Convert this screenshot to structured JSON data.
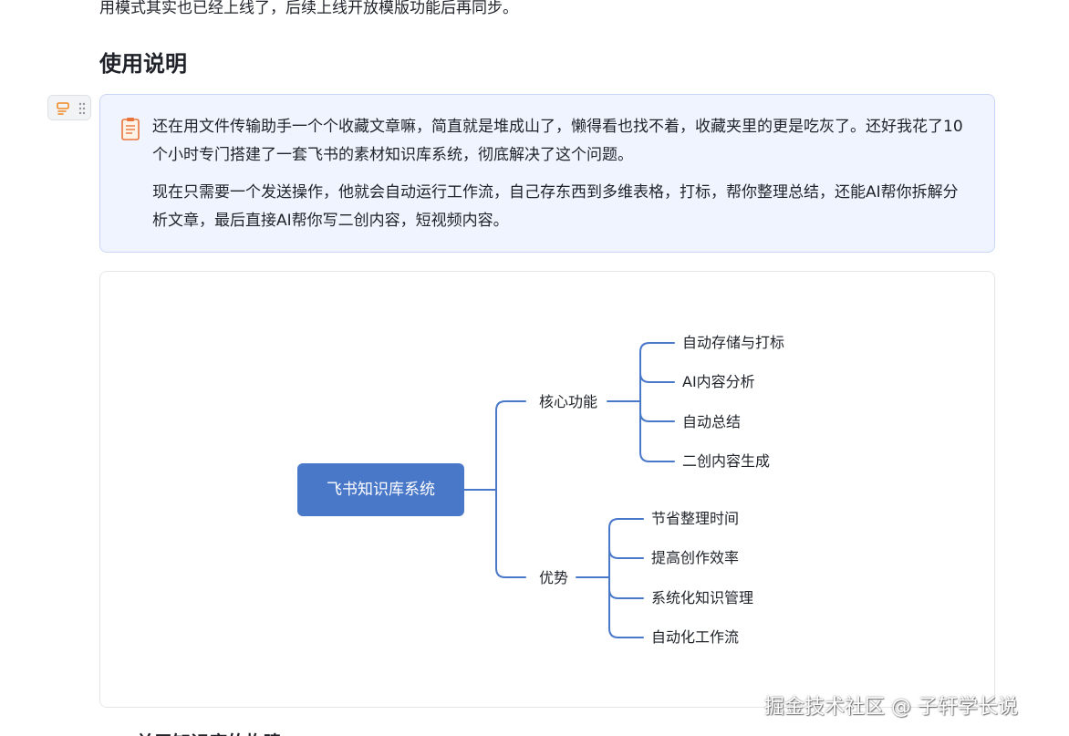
{
  "doc": {
    "top_line": "用模式其实也已经上线了，后续上线开放模版功能后再同步。",
    "heading": "使用说明",
    "bottom_heading_partial": "一、关于知识库的构建"
  },
  "callout": {
    "icon": "memo-icon",
    "paragraph1": "还在用文件传输助手一个个收藏文章嘛，简直就是堆成山了，懒得看也找不着，收藏夹里的更是吃灰了。还好我花了10个小时专门搭建了一套飞书的素材知识库系统，彻底解决了这个问题。",
    "paragraph2": "现在只需要一个发送操作，他就会自动运行工作流，自己存东西到多维表格，打标，帮你整理总结，还能AI帮你拆解分析文章，最后直接AI帮你写二创内容，短视频内容。"
  },
  "mindmap": {
    "root": "飞书知识库系统",
    "branches": [
      {
        "label": "核心功能",
        "children": [
          "自动存储与打标",
          "AI内容分析",
          "自动总结",
          "二创内容生成"
        ]
      },
      {
        "label": "优势",
        "children": [
          "节省整理时间",
          "提高创作效率",
          "系统化知识管理",
          "自动化工作流"
        ]
      }
    ],
    "colors": {
      "root_fill": "#4a78c9",
      "line": "#4a78c9"
    }
  },
  "watermark": "掘金技术社区 @ 子轩学长说"
}
